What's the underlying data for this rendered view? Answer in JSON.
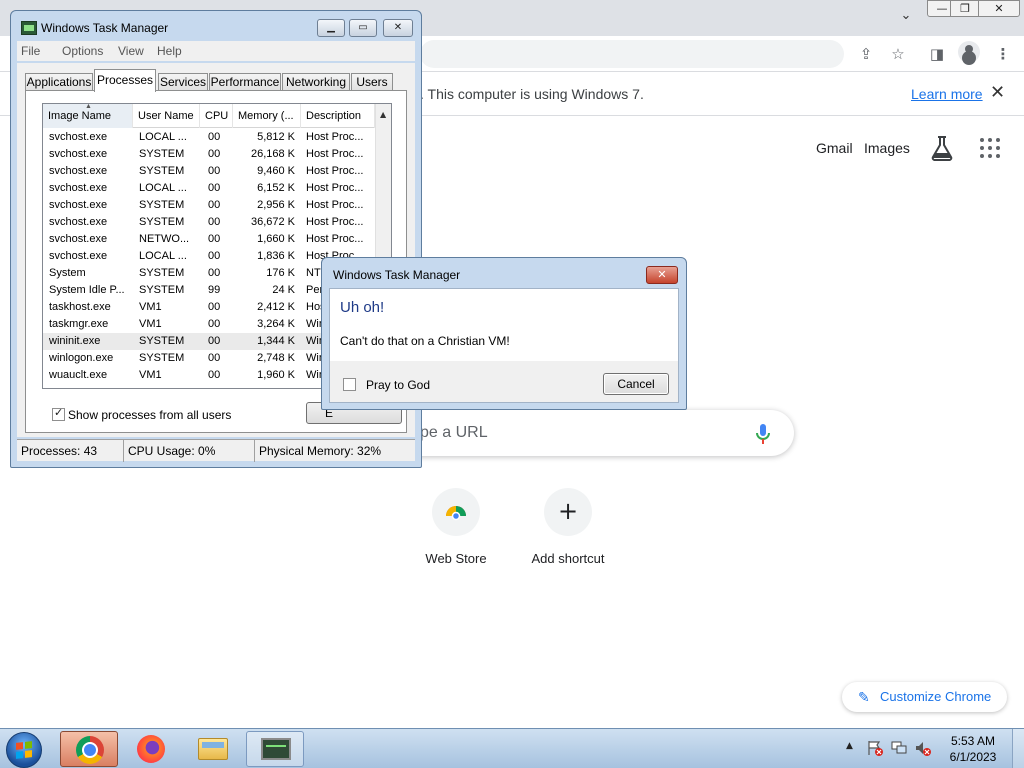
{
  "chrome": {
    "infobar_text": ". This computer is using Windows 7.",
    "learn_more": "Learn more",
    "info_close": "✕",
    "gmail": "Gmail",
    "images": "Images",
    "search_placeholder": "pe a URL",
    "shortcuts": [
      {
        "label": "Web Store"
      },
      {
        "label": "Add shortcut",
        "glyph": "+"
      }
    ],
    "customize": "Customize Chrome",
    "window_controls": {
      "min": "—",
      "max": "❐",
      "close": "✕"
    },
    "icons": [
      "tab-search-icon",
      "share-icon",
      "star-icon",
      "side-panel-icon",
      "profile-icon",
      "menu-icon",
      "labs-icon",
      "apps-icon",
      "mic-icon",
      "pencil-icon"
    ]
  },
  "taskmgr": {
    "title": "Windows Task Manager",
    "menu": [
      "File",
      "Options",
      "View",
      "Help"
    ],
    "tabs": [
      "Applications",
      "Processes",
      "Services",
      "Performance",
      "Networking",
      "Users"
    ],
    "active_tab": "Processes",
    "columns": [
      "Image Name",
      "User Name",
      "CPU",
      "Memory (...",
      "Description"
    ],
    "rows": [
      [
        "svchost.exe",
        "LOCAL ...",
        "00",
        "5,812 K",
        "Host Proc..."
      ],
      [
        "svchost.exe",
        "SYSTEM",
        "00",
        "26,168 K",
        "Host Proc..."
      ],
      [
        "svchost.exe",
        "SYSTEM",
        "00",
        "9,460 K",
        "Host Proc..."
      ],
      [
        "svchost.exe",
        "LOCAL ...",
        "00",
        "6,152 K",
        "Host Proc..."
      ],
      [
        "svchost.exe",
        "SYSTEM",
        "00",
        "2,956 K",
        "Host Proc..."
      ],
      [
        "svchost.exe",
        "SYSTEM",
        "00",
        "36,672 K",
        "Host Proc..."
      ],
      [
        "svchost.exe",
        "NETWO...",
        "00",
        "1,660 K",
        "Host Proc..."
      ],
      [
        "svchost.exe",
        "LOCAL ...",
        "00",
        "1,836 K",
        "Host Proc..."
      ],
      [
        "System",
        "SYSTEM",
        "00",
        "176 K",
        "NT"
      ],
      [
        "System Idle P...",
        "SYSTEM",
        "99",
        "24 K",
        "Per"
      ],
      [
        "taskhost.exe",
        "VM1",
        "00",
        "2,412 K",
        "Hos"
      ],
      [
        "taskmgr.exe",
        "VM1",
        "00",
        "3,264 K",
        "Win"
      ],
      [
        "wininit.exe",
        "SYSTEM",
        "00",
        "1,344 K",
        "Win"
      ],
      [
        "winlogon.exe",
        "SYSTEM",
        "00",
        "2,748 K",
        "Win"
      ],
      [
        "wuauclt.exe",
        "VM1",
        "00",
        "1,960 K",
        "Win"
      ]
    ],
    "selected_row": 12,
    "show_all_label": "Show processes from all users",
    "show_all_checked": true,
    "end_process_label": "E",
    "status": {
      "processes": "Processes: 43",
      "cpu": "CPU Usage: 0%",
      "memory": "Physical Memory: 32%"
    }
  },
  "dialog": {
    "title": "Windows Task Manager",
    "heading": "Uh oh!",
    "message": "Can't do that on a Christian VM!",
    "checkbox_label": "Pray to God",
    "checkbox_checked": false,
    "cancel": "Cancel"
  },
  "taskbar": {
    "apps": [
      "chrome",
      "firefox",
      "windows-explorer",
      "task-manager"
    ],
    "clock_time": "5:53 AM",
    "clock_date": "6/1/2023"
  },
  "colors": {
    "chrome_blue": "#1a73e8",
    "dialog_heading": "#1e3a87",
    "win_frame": "#c6d9ee"
  }
}
